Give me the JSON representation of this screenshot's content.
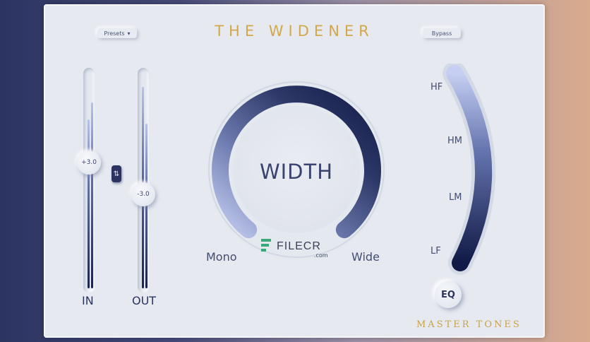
{
  "header": {
    "presets_label": "Presets",
    "presets_arrow": "▾",
    "title": "THE WIDENER",
    "bypass_label": "Bypass"
  },
  "faders": {
    "in": {
      "label": "IN",
      "value": "+3.0",
      "meter_levels": [
        0.78,
        0.86
      ]
    },
    "out": {
      "label": "OUT",
      "value": "-3.0",
      "meter_levels": [
        0.93,
        0.76
      ]
    },
    "link_icon": "⇅"
  },
  "width": {
    "label": "WIDTH",
    "min_label": "Mono",
    "max_label": "Wide",
    "level": 1.0
  },
  "eq": {
    "bands": [
      "HF",
      "HM",
      "LM",
      "LF"
    ],
    "button_label": "EQ"
  },
  "watermark": {
    "text": "FILECR",
    "sub": ".com"
  },
  "brand": "MASTER TONES",
  "colors": {
    "panel": "#e6e9f0",
    "title_gold": "#d2a84a",
    "navy": "#1a2250",
    "light_blue": "#b8c3ec"
  }
}
